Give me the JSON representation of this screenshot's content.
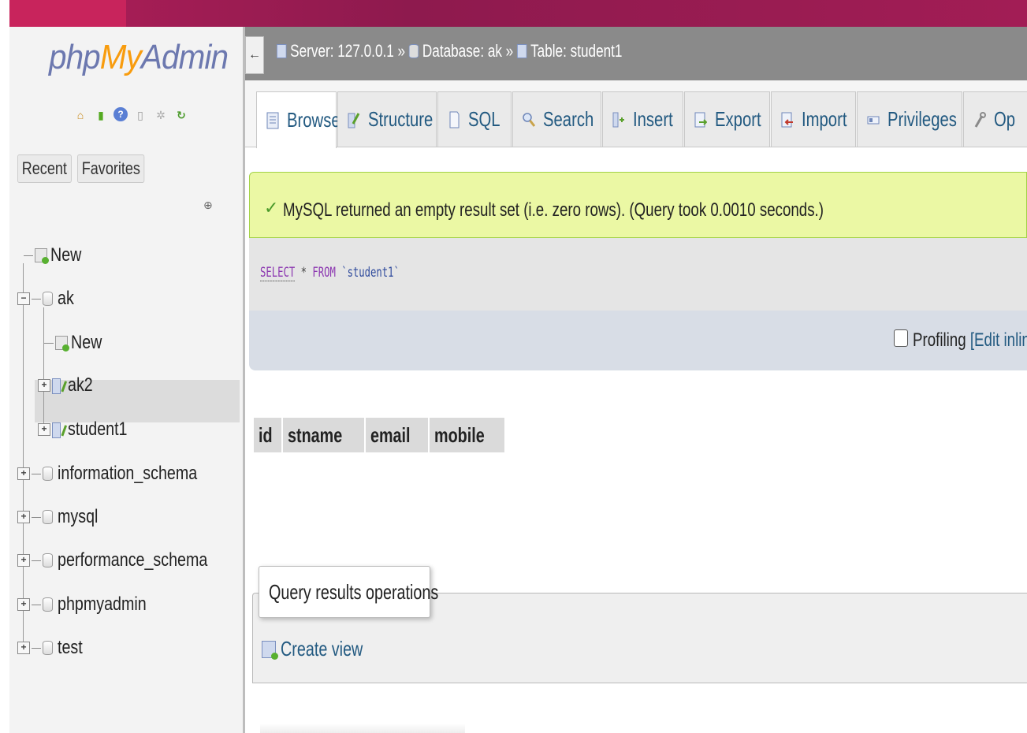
{
  "sidebar": {
    "logo": {
      "part1": "php",
      "part2": "My",
      "part3": "Admin"
    },
    "quick_icons": [
      "home-icon",
      "logout-icon",
      "help-icon",
      "docs-icon",
      "settings-icon",
      "reload-icon"
    ],
    "tabs": {
      "recent": "Recent",
      "favorites": "Favorites"
    },
    "tree": {
      "new_root": "New",
      "ak": "ak",
      "ak_new": "New",
      "ak2": "ak2",
      "student1": "student1",
      "information_schema": "information_schema",
      "mysql": "mysql",
      "performance_schema": "performance_schema",
      "phpmyadmin": "phpmyadmin",
      "test": "test"
    }
  },
  "breadcrumb": {
    "back": "←",
    "server": "Server: 127.0.0.1",
    "sep1": "»",
    "database": "Database: ak",
    "sep2": "»",
    "table": "Table: student1"
  },
  "tabs": [
    {
      "label": "Browse",
      "icon": "browse-icon",
      "active": true
    },
    {
      "label": "Structure",
      "icon": "structure-icon"
    },
    {
      "label": "SQL",
      "icon": "sql-icon"
    },
    {
      "label": "Search",
      "icon": "search-icon"
    },
    {
      "label": "Insert",
      "icon": "insert-icon"
    },
    {
      "label": "Export",
      "icon": "export-icon"
    },
    {
      "label": "Import",
      "icon": "import-icon"
    },
    {
      "label": "Privileges",
      "icon": "privileges-icon"
    },
    {
      "label": "Op",
      "icon": "operations-icon"
    }
  ],
  "message": {
    "text": "MySQL returned an empty result set (i.e. zero rows). (Query took 0.0010 seconds.)"
  },
  "query": {
    "select": "SELECT",
    "star": " * ",
    "from": "FROM",
    "table": " `student1`"
  },
  "profiling": {
    "label": "Profiling",
    "link": "[Edit inline"
  },
  "result_columns": [
    "id",
    "stname",
    "email",
    "mobile"
  ],
  "operations": {
    "legend": "Query results operations",
    "create_view": "Create view"
  },
  "colors": {
    "topbar": "#a21d55",
    "link": "#235a81",
    "success_bg": "#ebf8a4",
    "logo_blue": "#6c78af",
    "logo_orange": "#f89c0e"
  }
}
